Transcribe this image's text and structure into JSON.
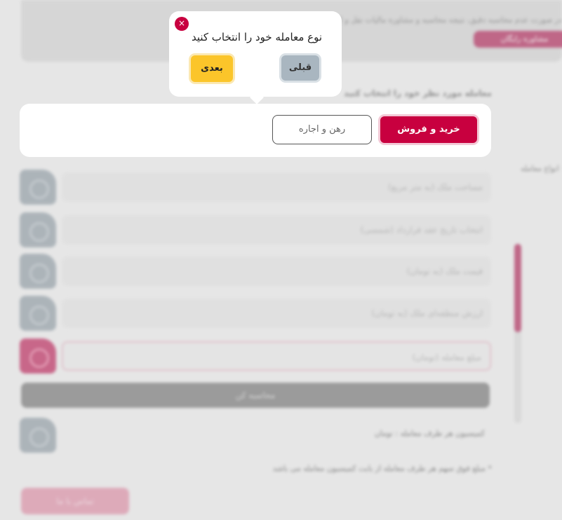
{
  "background": {
    "banner_text": "در صورت عدم محاسبه دقیق، نتیجه محاسبه و مشاوره مالیات نقل و انتقال",
    "banner_pill": "مشاوره رایگان",
    "title": "معامله مورد نظر خود را انتخاب کنید",
    "fields": [
      {
        "placeholder": "مساحت ملک (به متر مربع)"
      },
      {
        "placeholder": "انتخاب تاریخ عقد قرارداد (شمسی)"
      },
      {
        "placeholder": "قیمت ملک (به تومان)"
      },
      {
        "placeholder": "ارزش منطقه‌ای ملک (به تومان)"
      },
      {
        "placeholder": "مبلغ معامله (تومان)"
      }
    ],
    "calc_button": "محاسبه کن",
    "result_label": "کمیسیون هر طرف معامله : تومان",
    "note": "* مبلغ فوق سهم هر طرف معامله از بابت کمیسیون معامله می باشد",
    "bottom_button": "تماس با ما",
    "side_text": "انواع معامله"
  },
  "card": {
    "buy_sell_label": "خرید و فروش",
    "rent_label": "رهن و اجاره"
  },
  "popover": {
    "title": "نوع معامله خود را انتخاب کنید",
    "close_glyph": "×",
    "next_label": "بعدی",
    "prev_label": "قبلی"
  },
  "colors": {
    "accent": "#c8003f",
    "next": "#fbc52a",
    "prev": "#a9b6c0"
  }
}
